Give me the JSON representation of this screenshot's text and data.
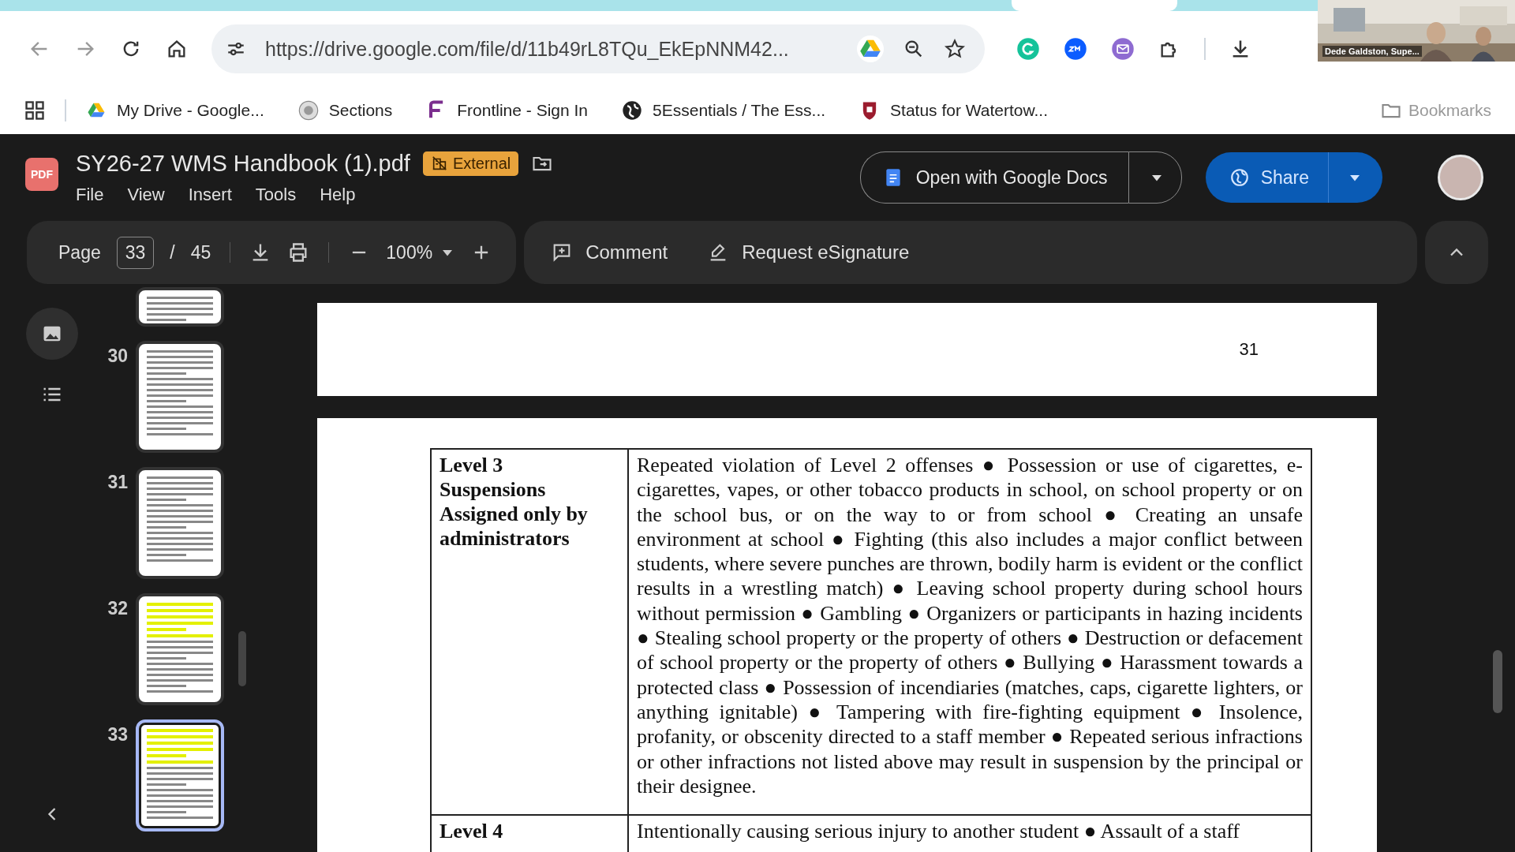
{
  "browser": {
    "url": "https://drive.google.com/file/d/11b49rL8TQu_EkEpNNM42...",
    "bookmarks": [
      {
        "label": "My Drive - Google..."
      },
      {
        "label": "Sections"
      },
      {
        "label": "Frontline - Sign In"
      },
      {
        "label": "5Essentials / The Ess..."
      },
      {
        "label": "Status for Watertow..."
      }
    ],
    "all_bookmarks": "Bookmarks"
  },
  "video_call": {
    "participant": "Dede Galdston, Supe..."
  },
  "file": {
    "badge": "PDF",
    "title": "SY26-27 WMS Handbook (1).pdf",
    "label": "External",
    "menu": [
      "File",
      "View",
      "Insert",
      "Tools",
      "Help"
    ],
    "open_with": "Open with Google Docs",
    "share": "Share"
  },
  "toolbar": {
    "page_label": "Page",
    "page": "33",
    "separator": "/",
    "total": "45",
    "zoom": "100%",
    "comment": "Comment",
    "esign": "Request eSignature"
  },
  "thumbnails": [
    {
      "kind": "cut",
      "selected": false,
      "highlighted": false
    },
    {
      "kind": "page",
      "number": "30",
      "selected": false,
      "highlighted": false
    },
    {
      "kind": "page",
      "number": "31",
      "selected": false,
      "highlighted": false
    },
    {
      "kind": "page",
      "number": "32",
      "selected": false,
      "highlighted": true
    },
    {
      "kind": "page",
      "number": "33",
      "selected": true,
      "highlighted": true
    }
  ],
  "pages": [
    {
      "kind": "tail",
      "page_number": "31"
    },
    {
      "kind": "table",
      "rows": [
        {
          "heading": "Level 3\nSuspensions\nAssigned only by\nadministrators",
          "text": "Repeated violation of Level 2 offenses ● Possession or use of cigarettes, e-cigarettes, vapes, or other tobacco products in school, on school property or on the school bus, or on the way to or from school ● Creating an unsafe environment at school ● Fighting (this also includes a major conflict between students, where severe punches are thrown, bodily harm is evident or the conflict results in a wrestling match) ● Leaving school property during school hours without permission ● Gambling ● Organizers or participants in hazing incidents ● Stealing school property or the property of others ● Destruction or defacement of school property or the property of others ● Bullying ● Harassment towards a protected class ● Possession of incendiaries (matches, caps, cigarette lighters, or anything ignitable) ● Tampering with fire-fighting equipment ● Insolence, profanity, or obscenity directed to a staff member ● Repeated serious infractions or other infractions not listed above may result in suspension by the principal or their designee."
        },
        {
          "heading": "Level 4",
          "text": "Intentionally causing serious injury to another student ● Assault of a staff"
        }
      ]
    }
  ]
}
